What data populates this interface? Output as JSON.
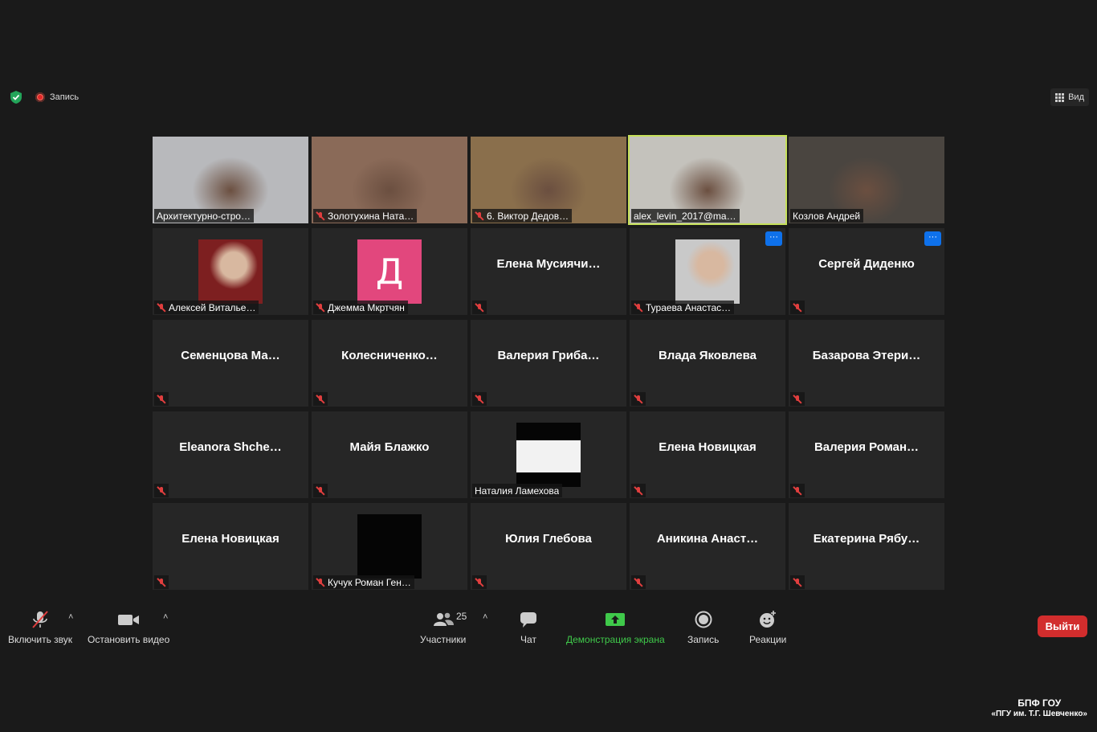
{
  "topbar": {
    "record_label": "Запись",
    "view_label": "Вид"
  },
  "tiles": [
    {
      "name": "Архитектурно-стро…",
      "muted": false,
      "kind": "video",
      "bg": "#b8b9bc"
    },
    {
      "name": "Золотухина Ната…",
      "muted": true,
      "kind": "video",
      "bg": "#8a6a58"
    },
    {
      "name": "6. Виктор Дедов…",
      "muted": true,
      "kind": "video",
      "bg": "#8a6f4c"
    },
    {
      "name": "alex_levin_2017@ma…",
      "muted": false,
      "kind": "video",
      "bg": "#c4c2bc",
      "active": true
    },
    {
      "name": "Козлов Андрей",
      "muted": false,
      "kind": "video",
      "bg": "#4a4540"
    },
    {
      "name": "Алексей Виталье…",
      "muted": true,
      "kind": "avatar-photo",
      "bg": "#7d1f20"
    },
    {
      "name": "Джемма Мкртчян",
      "muted": true,
      "kind": "avatar-letter",
      "letter": "Д"
    },
    {
      "name": "Елена  Мусиячи…",
      "muted": true,
      "kind": "name"
    },
    {
      "name": "Тураева Анастас…",
      "muted": true,
      "kind": "avatar-photo",
      "bg": "#c9c9c9",
      "more": "···"
    },
    {
      "name": "Сергей Диденко",
      "muted": true,
      "kind": "name",
      "more": "···"
    },
    {
      "name": "Семенцова  Ма…",
      "muted": true,
      "kind": "name"
    },
    {
      "name": "Колесниченко…",
      "muted": true,
      "kind": "name"
    },
    {
      "name": "Валерия  Гриба…",
      "muted": true,
      "kind": "name"
    },
    {
      "name": "Влада Яковлева",
      "muted": true,
      "kind": "name"
    },
    {
      "name": "Базарова  Этери…",
      "muted": true,
      "kind": "name"
    },
    {
      "name": "Eleanora  Shche…",
      "muted": true,
      "kind": "name"
    },
    {
      "name": "Майя Блажко",
      "muted": true,
      "kind": "name"
    },
    {
      "name": "Наталия Ламехова",
      "muted": false,
      "kind": "avatar-card",
      "bg": "#050505"
    },
    {
      "name": "Елена Новицкая",
      "muted": true,
      "kind": "name"
    },
    {
      "name": "Валерия  Роман…",
      "muted": true,
      "kind": "name"
    },
    {
      "name": "Елена Новицкая",
      "muted": true,
      "kind": "name"
    },
    {
      "name": "Кучук Роман Ген…",
      "muted": true,
      "kind": "avatar-dark",
      "bg": "#050505"
    },
    {
      "name": "Юлия Глебова",
      "muted": true,
      "kind": "name"
    },
    {
      "name": "Аникина  Анаст…",
      "muted": true,
      "kind": "name"
    },
    {
      "name": "Екатерина  Рябу…",
      "muted": true,
      "kind": "name"
    }
  ],
  "toolbar": {
    "audio_label": "Включить звук",
    "video_label": "Остановить видео",
    "participants_label": "Участники",
    "participants_count": "25",
    "chat_label": "Чат",
    "share_label": "Демонстрация экрана",
    "record_label": "Запись",
    "reactions_label": "Реакции",
    "leave_label": "Выйти",
    "caret": "˄"
  },
  "watermark": {
    "line1": "БПФ ГОУ",
    "line2": "«ПГУ им. Т.Г. Шевченко»"
  },
  "colors": {
    "background": "#1a1a1a",
    "tile": "#262626",
    "active_border": "#c6e05a",
    "leave": "#d22d2d",
    "share": "#3fc94a",
    "more": "#0e71eb"
  }
}
